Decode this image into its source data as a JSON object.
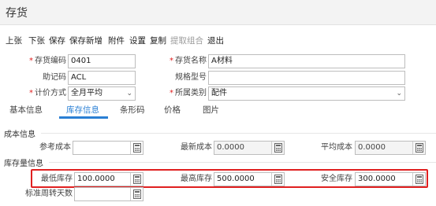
{
  "title": "存货",
  "toolbar": {
    "items": [
      "上张",
      "下张",
      "保存",
      "保存新增",
      "附件",
      "设置",
      "复制",
      "提取组合",
      "退出"
    ]
  },
  "form": {
    "code": {
      "label": "存货编码",
      "value": "0401"
    },
    "name": {
      "label": "存货名称",
      "value": "A材料"
    },
    "mnemonic": {
      "label": "助记码",
      "value": "ACL"
    },
    "spec": {
      "label": "规格型号",
      "value": ""
    },
    "costing": {
      "label": "计价方式",
      "value": "全月平均"
    },
    "category": {
      "label": "所属类别",
      "value": "配件"
    }
  },
  "tabs": [
    "基本信息",
    "库存信息",
    "条形码",
    "价格",
    "图片"
  ],
  "active_tab": "库存信息",
  "cost_section": {
    "title": "成本信息",
    "ref_cost": {
      "label": "参考成本",
      "value": ""
    },
    "latest_cost": {
      "label": "最新成本",
      "value": "0.0000"
    },
    "avg_cost": {
      "label": "平均成本",
      "value": "0.0000"
    }
  },
  "stock_section": {
    "title": "库存量信息",
    "min_stock": {
      "label": "最低库存",
      "value": "100.0000"
    },
    "max_stock": {
      "label": "最高库存",
      "value": "500.0000"
    },
    "safety_stock": {
      "label": "安全库存",
      "value": "300.0000"
    },
    "turnover_days": {
      "label": "标准周转天数",
      "value": ""
    }
  },
  "colors": {
    "accent": "#2a7fd4",
    "required": "#e02020",
    "highlight": "#e02020"
  }
}
